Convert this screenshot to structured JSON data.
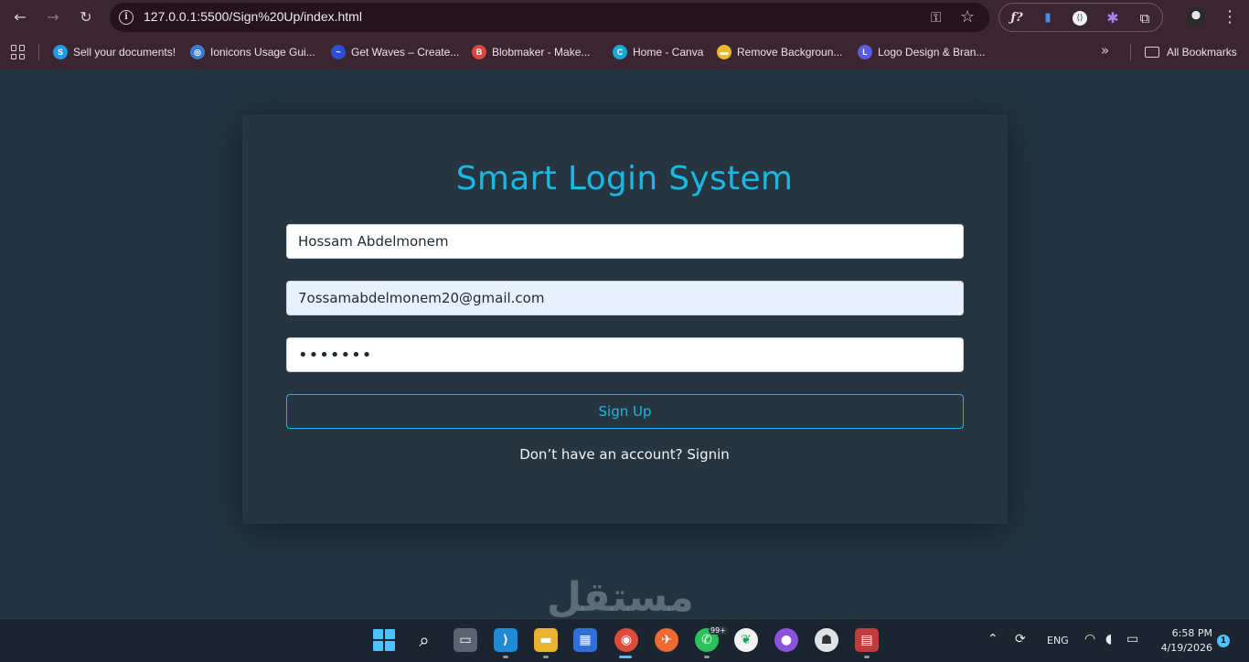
{
  "browser": {
    "url": "127.0.0.1:5500/Sign%20Up/index.html",
    "bookmarks": [
      {
        "label": "Sell your documents!",
        "color": "#1e9be8",
        "glyph": "S"
      },
      {
        "label": "Ionicons Usage Gui...",
        "color": "#3a7bd5",
        "glyph": "◎"
      },
      {
        "label": "Get Waves – Create...",
        "color": "#2b4fd8",
        "glyph": "~"
      },
      {
        "label": "Blobmaker - Make...",
        "color": "#e0443c",
        "glyph": "B"
      },
      {
        "label": "Home - Canva",
        "color": "#19a6d6",
        "glyph": "C"
      },
      {
        "label": "Remove Backgroun...",
        "color": "#e8b82e",
        "glyph": "▬"
      },
      {
        "label": "Logo Design & Bran...",
        "color": "#5b5be0",
        "glyph": "L"
      }
    ],
    "all_bookmarks": "All Bookmarks"
  },
  "page": {
    "title": "Smart Login System",
    "name_value": "Hossam Abdelmonem",
    "email_value": "7ossamabdelmonem20@gmail.com",
    "password_value": "•••••••",
    "signup_label": "Sign Up",
    "account_prompt": "Don’t have an account? ",
    "signin_label": "Signin"
  },
  "watermark": "مستقل",
  "taskbar": {
    "language": "ENG",
    "time": "6:58 PM",
    "date": "4/19/2026",
    "notifications": "1",
    "whatsapp_badge": "99+"
  },
  "colors": {
    "accent": "#19b8e4",
    "page_bg": "#233440",
    "card_bg": "#263540",
    "chrome_bg": "#3a2531"
  }
}
